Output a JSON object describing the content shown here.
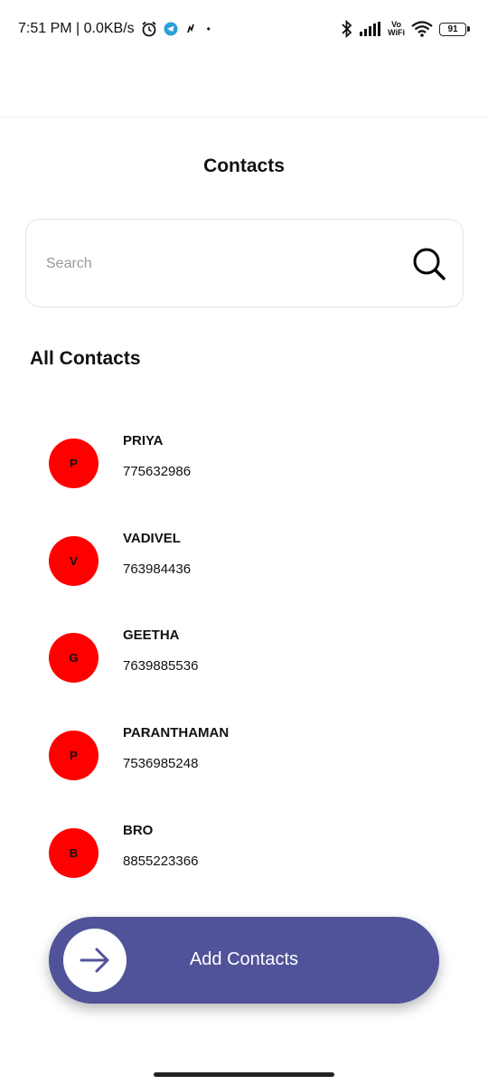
{
  "status_bar": {
    "time_speed": "7:51 PM | 0.0KB/s",
    "dot": "•",
    "volte_top": "Vo",
    "volte_bottom": "WiFi",
    "battery": "91",
    "icons": [
      "alarm-icon",
      "telegram-icon",
      "network-activity-icon",
      "bluetooth-icon",
      "signal-icon",
      "wifi-icon",
      "battery-icon"
    ]
  },
  "header": {
    "title": "Contacts"
  },
  "search": {
    "placeholder": "Search",
    "value": ""
  },
  "section": {
    "title": "All Contacts"
  },
  "contacts": [
    {
      "initial": "P",
      "name": "PRIYA",
      "phone": "775632986"
    },
    {
      "initial": "V",
      "name": "VADIVEL",
      "phone": "763984436"
    },
    {
      "initial": "G",
      "name": "GEETHA",
      "phone": "7639885536"
    },
    {
      "initial": "P",
      "name": "PARANTHAMAN",
      "phone": "7536985248"
    },
    {
      "initial": "B",
      "name": "BRO",
      "phone": "8855223366"
    }
  ],
  "add_button": {
    "label": "Add Contacts",
    "icon": "arrow-right-icon"
  },
  "colors": {
    "avatar": "#ff0000",
    "button": "#51539a",
    "cursor": "#1fbf9f"
  }
}
